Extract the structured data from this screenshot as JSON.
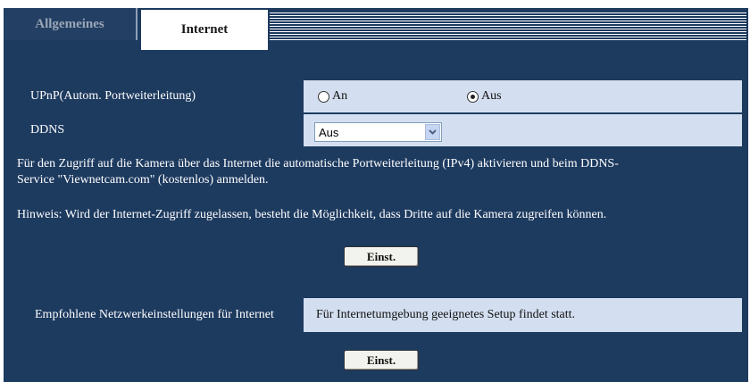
{
  "tabs": {
    "allgemeines": "Allgemeines",
    "internet": "Internet"
  },
  "upnp": {
    "label": "UPnP(Autom. Portweiterleitung)",
    "option_on": "An",
    "option_off": "Aus",
    "selected": "Aus"
  },
  "ddns": {
    "label": "DDNS",
    "value": "Aus",
    "arrow_icon": "chevron-down-icon"
  },
  "info": {
    "line1": "Für den Zugriff auf die Kamera über das Internet die automatische Portweiterleitung (IPv4) aktivieren und beim DDNS-",
    "line2": "Service \"Viewnetcam.com\" (kostenlos) anmelden.",
    "hint": "Hinweis: Wird der Internet-Zugriff zugelassen, besteht die Möglichkeit, dass Dritte auf die Kamera zugreifen können."
  },
  "buttons": {
    "set1": "Einst.",
    "set2": "Einst."
  },
  "recommended": {
    "label": "Empfohlene Netzwerkeinstellungen für Internet",
    "value": "Für Internetumgebung geeignetes Setup findet statt."
  },
  "colors": {
    "panel": "#1d3a5f",
    "value_cell": "#d3dff0"
  }
}
